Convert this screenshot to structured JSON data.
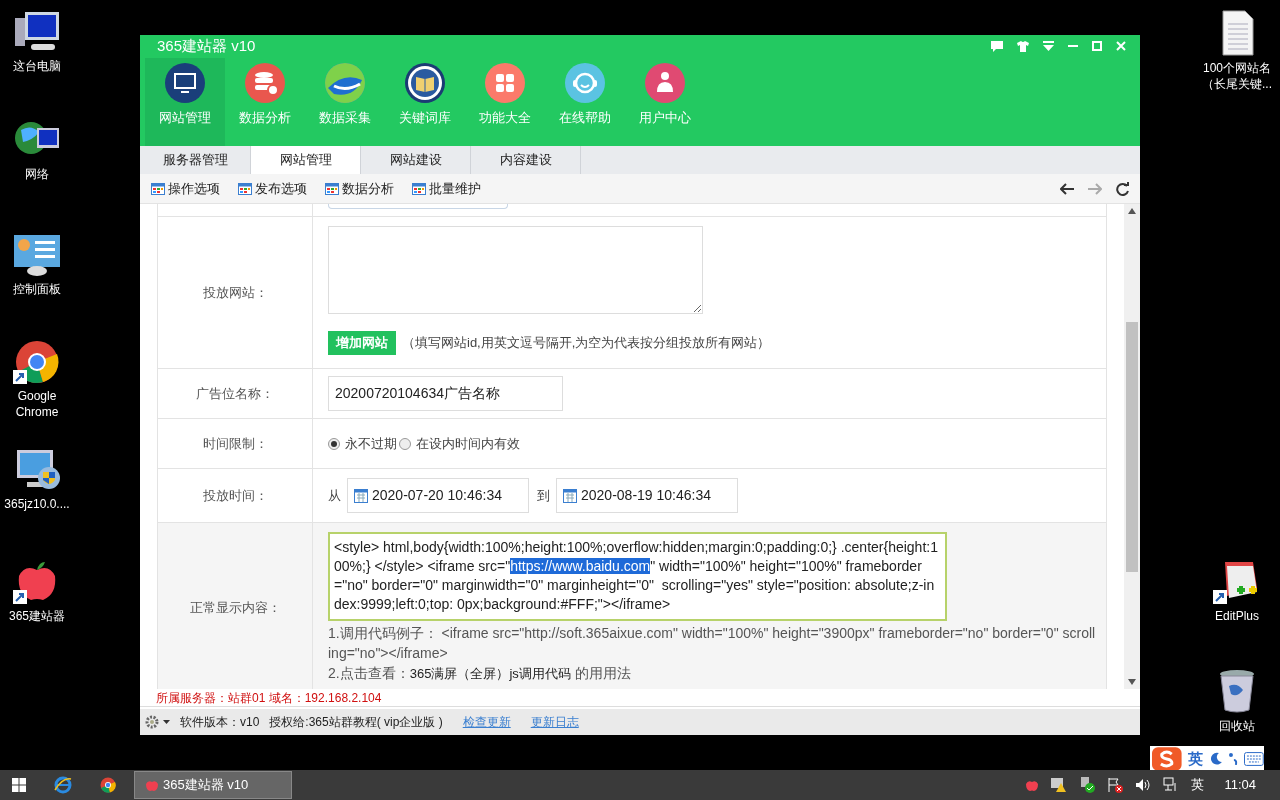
{
  "desktop_left": [
    {
      "label": "这台电脑"
    },
    {
      "label": "网络"
    },
    {
      "label": "控制面板"
    },
    {
      "label": "Google Chrome"
    },
    {
      "label": "365jz10.0...."
    },
    {
      "label": "365建站器"
    }
  ],
  "desktop_right": [
    {
      "label": "100个网站名（长尾关键..."
    },
    {
      "label": "EditPlus"
    },
    {
      "label": "回收站"
    }
  ],
  "window": {
    "title": "365建站器 v10"
  },
  "nav_items": [
    {
      "label": "网站管理",
      "selected": true
    },
    {
      "label": "数据分析",
      "selected": false
    },
    {
      "label": "数据采集",
      "selected": false
    },
    {
      "label": "关键词库",
      "selected": false
    },
    {
      "label": "功能大全",
      "selected": false
    },
    {
      "label": "在线帮助",
      "selected": false
    },
    {
      "label": "用户中心",
      "selected": false
    }
  ],
  "tabs": [
    {
      "label": "服务器管理",
      "selected": false
    },
    {
      "label": "网站管理",
      "selected": true
    },
    {
      "label": "网站建设",
      "selected": false
    },
    {
      "label": "内容建设",
      "selected": false
    }
  ],
  "toolbar": [
    "操作选项",
    "发布选项",
    "数据分析",
    "批量维护"
  ],
  "form": {
    "sites": {
      "label": "投放网站：",
      "button": "增加网站",
      "hint": "（填写网站id,用英文逗号隔开,为空为代表按分组投放所有网站）"
    },
    "ad_name": {
      "label": "广告位名称：",
      "value": "20200720104634广告名称"
    },
    "time_limit": {
      "label": "时间限制：",
      "options": [
        {
          "label": "永不过期",
          "selected": true
        },
        {
          "label": "在设内时间内有效",
          "selected": false
        }
      ]
    },
    "period": {
      "label": "投放时间：",
      "from": "从",
      "start": "2020-07-20 10:46:34",
      "to": "到",
      "end": "2020-08-19 10:46:34"
    },
    "content": {
      "label": "正常显示内容：",
      "code_before": "<style> html,body{width:100%;height:100%;overflow:hidden;margin:0;padding:0;} .center{height:100%;} </style> <iframe src=\"",
      "code_selected": "https://www.baidu.com",
      "code_after": "\" width=\"100%\" height=\"100%\" frameborder=\"no\" border=\"0\" marginwidth=\"0\" marginheight=\"0\"  scrolling=\"yes\" style=\"position: absolute;z-index:9999;left:0;top: 0px;background:#FFF;\"></iframe>",
      "note_1": "1.调用代码例子： <iframe src=\"http://soft.365aixue.com\" width=\"100%\" height=\"3900px\" frameborder=\"no\" border=\"0\" scrolling=\"no\"></iframe>",
      "note_2": "2.点击查看：",
      "note_2_link": "365满屏（全屏）js调用代码",
      "note_2_after": "的用用法"
    }
  },
  "server_info": "所属服务器：站群01 域名：192.168.2.104",
  "status_bar": {
    "version": "软件版本：v10",
    "license": "授权给:365站群教程( vip企业版 )",
    "links": [
      "检查更新",
      "更新日志"
    ]
  },
  "taskbar": {
    "app": "365建站器 v10",
    "ime": "英",
    "time": "11:04"
  },
  "ime_bar": {
    "mode": "英"
  }
}
